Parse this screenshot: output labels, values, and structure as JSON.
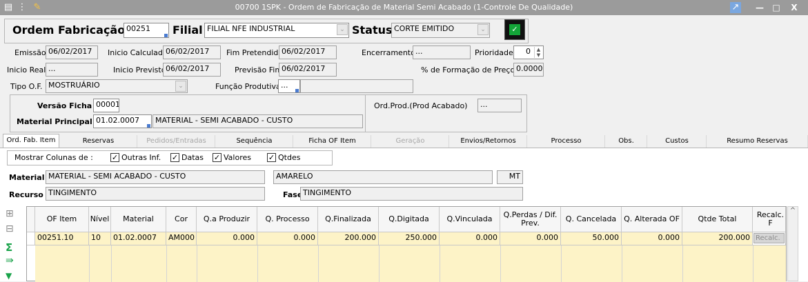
{
  "window": {
    "title": "00700 1SPK - Ordem de Fabricação de Material Semi Acabado (1-Controle De Qualidade)"
  },
  "header": {
    "ordem_label": "Ordem Fabricação",
    "ordem_value": "00251",
    "filial_label": "Filial",
    "filial_value": "FILIAL NFE INDUSTRIAL",
    "status_label": "Status",
    "status_value": "CORTE EMITIDO"
  },
  "dates": {
    "emissao_label": "Emissão",
    "emissao_value": "06/02/2017",
    "inicio_calc_label": "Inicio Calculado",
    "inicio_calc_value": "06/02/2017",
    "fim_pret_label": "Fim Pretendido",
    "fim_pret_value": "06/02/2017",
    "encerramento_label": "Encerramento",
    "encerramento_value": "...",
    "prioridade_label": "Prioridade",
    "prioridade_value": "0",
    "inicio_real_label": "Inicio Real",
    "inicio_real_value": "...",
    "inicio_prev_label": "Inicio Previsto",
    "inicio_prev_value": "06/02/2017",
    "previsao_fim_label": "Previsão Fim",
    "previsao_fim_value": "06/02/2017",
    "formacao_label": "% de Formação de Preço",
    "formacao_value": "0.0000",
    "tipo_of_label": "Tipo O.F.",
    "tipo_of_value": "MOSTRUÁRIO",
    "funcao_label": "Função Produtiva",
    "funcao_value": "..."
  },
  "ficha": {
    "versao_label": "Versão Ficha",
    "versao_value": "00001",
    "material_label": "Material Principal",
    "material_code": "01.02.0007",
    "material_desc": "MATERIAL - SEMI ACABADO - CUSTO",
    "ordprod_label": "Ord.Prod.(Prod Acabado)",
    "ordprod_value": "..."
  },
  "tabs": [
    {
      "label": "Ord. Fab. Item"
    },
    {
      "label": "Reservas"
    },
    {
      "label": "Pedidos/Entradas"
    },
    {
      "label": "Sequência"
    },
    {
      "label": "Ficha OF Item"
    },
    {
      "label": "Geração"
    },
    {
      "label": "Envios/Retornos"
    },
    {
      "label": "Processo"
    },
    {
      "label": "Obs."
    },
    {
      "label": "Custos"
    },
    {
      "label": "Resumo Reservas"
    }
  ],
  "columns_opts": {
    "label": "Mostrar Colunas de :",
    "outras": "Outras Inf.",
    "datas": "Datas",
    "valores": "Valores",
    "qtdes": "Qtdes"
  },
  "item": {
    "material_label": "Material",
    "material_value": "MATERIAL - SEMI ACABADO - CUSTO",
    "cor_value": "AMARELO",
    "unidade": "MT",
    "recurso_label": "Recurso",
    "recurso_value": "TINGIMENTO",
    "fase_label": "Fase",
    "fase_value": "TINGIMENTO"
  },
  "grid": {
    "headers": [
      "OF Item",
      "Nível",
      "Material",
      "Cor",
      "Q.a Produzir",
      "Q. Processo",
      "Q.Finalizada",
      "Q.Digitada",
      "Q.Vinculada",
      "Q.Perdas / Dif. Prev.",
      "Q. Cancelada",
      "Q. Alterada OF",
      "Qtde Total",
      "Recalc. F"
    ],
    "rows": [
      [
        "00251.10",
        "10",
        "01.02.0007",
        "AM000",
        "0.000",
        "0.000",
        "200.000",
        "250.000",
        "0.000",
        "0.000",
        "50.000",
        "0.000",
        "200.000",
        "Recalc."
      ]
    ]
  }
}
